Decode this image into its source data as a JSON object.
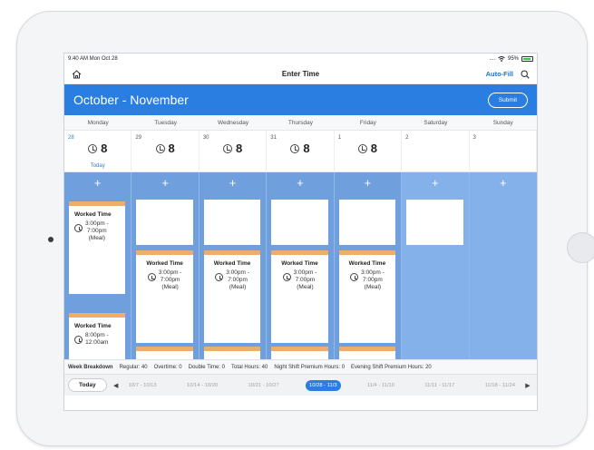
{
  "status": {
    "time": "9:40 AM  Mon Oct 28",
    "signal": "....",
    "battery": "95%"
  },
  "nav": {
    "title": "Enter Time",
    "autofill": "Auto-Fill"
  },
  "banner": {
    "title": "October - November",
    "submit": "Submit"
  },
  "weekdays": [
    "Monday",
    "Tuesday",
    "Wednesday",
    "Thursday",
    "Friday",
    "Saturday",
    "Sunday"
  ],
  "dates": [
    {
      "num": "28",
      "hours": "8",
      "today": "Today"
    },
    {
      "num": "29",
      "hours": "8"
    },
    {
      "num": "30",
      "hours": "8"
    },
    {
      "num": "31",
      "hours": "8"
    },
    {
      "num": "1",
      "hours": "8"
    },
    {
      "num": "2"
    },
    {
      "num": "3"
    }
  ],
  "plus": "+",
  "entries": {
    "monday_a": {
      "title": "Worked Time",
      "t1": "3:00pm -",
      "t2": "7:00pm",
      "t3": "(Meal)"
    },
    "monday_b": {
      "title": "Worked Time",
      "t1": "8:00pm -",
      "t2": "12:00am"
    },
    "tuesday": {
      "title": "Worked Time",
      "t1": "3:00pm -",
      "t2": "7:00pm",
      "t3": "(Meal)"
    },
    "wednesday": {
      "title": "Worked Time",
      "t1": "3:00pm -",
      "t2": "7:00pm",
      "t3": "(Meal)"
    },
    "thursday": {
      "title": "Worked Time",
      "t1": "3:00pm -",
      "t2": "7:00pm",
      "t3": "(Meal)"
    },
    "friday": {
      "title": "Worked Time",
      "t1": "3:00pm -",
      "t2": "7:00pm",
      "t3": "(Meal)"
    }
  },
  "breakdown": {
    "label": "Week Breakdown",
    "regular": "Regular: 40",
    "overtime": "Overtime: 0",
    "double": "Double Time: 0",
    "total": "Total Hours: 40",
    "night": "Night Shift Premium Hours: 0",
    "evening": "Evening Shift Premium Hours: 20"
  },
  "weeknav": {
    "today": "Today",
    "ranges": [
      "10/7 - 10/13",
      "10/14 - 10/20",
      "10/21 - 10/27",
      "10/28 - 11/3",
      "11/4 - 11/10",
      "11/11 - 11/17",
      "11/18 - 11/24"
    ],
    "selected_index": 3
  },
  "colors": {
    "accent": "#2a7de1",
    "column": "#6f9fdc",
    "entry_bar": "#efad6c"
  }
}
